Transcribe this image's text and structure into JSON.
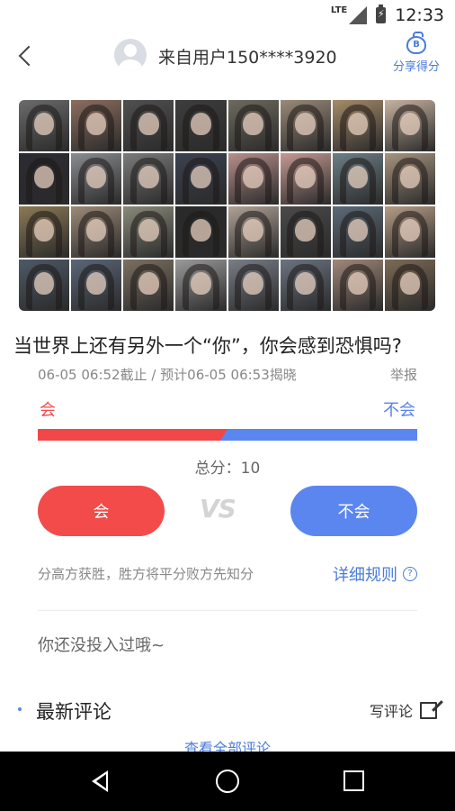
{
  "status_bar": {
    "network": "LTE",
    "time": "12:33"
  },
  "header": {
    "user_title": "来自用户150****3920",
    "share_label": "分享得分",
    "share_icon": "money-bag-icon"
  },
  "photo_grid": {
    "rows": 4,
    "columns": 8,
    "tones": [
      "#6b6b6b",
      "#8c6e5e",
      "#505050",
      "#3d3d3d",
      "#6e6a5e",
      "#9a8a78",
      "#a58b68",
      "#c7b3a0",
      "#2b2b33",
      "#8a8c90",
      "#7b7b7b",
      "#3a4150",
      "#b78f8a",
      "#c49a92",
      "#6c7f86",
      "#a6947e",
      "#8c7a55",
      "#9d8a78",
      "#8a8a7a",
      "#2a2a2a",
      "#b0a296",
      "#4a4a4a",
      "#5c6a78",
      "#b59c86",
      "#4d5a66",
      "#5a6678",
      "#7c7060",
      "#9a9a9a",
      "#787e86",
      "#6a7480",
      "#a08878",
      "#7d6a55"
    ]
  },
  "question": "当世界上还有另外一个“你”，你会感到恐惧吗?",
  "deadline": "06-05 06:52截止 / 预计06-05 06:53揭晓",
  "report_label": "举报",
  "vote": {
    "option_a": "会",
    "option_b": "不会",
    "share_a": 0.5,
    "total_label": "总分：10",
    "vs_label": "VS",
    "button_a": "会",
    "button_b": "不会",
    "color_a": "#f34a4a",
    "color_b": "#5b86f0"
  },
  "rules": {
    "text": "分高方获胜，胜方将平分败方先知分",
    "link": "详细规则",
    "help_icon": "?"
  },
  "not_voted_text": "你还没投入过哦~",
  "comments": {
    "title": "最新评论",
    "write_label": "写评论",
    "view_all": "查看全部评论"
  }
}
